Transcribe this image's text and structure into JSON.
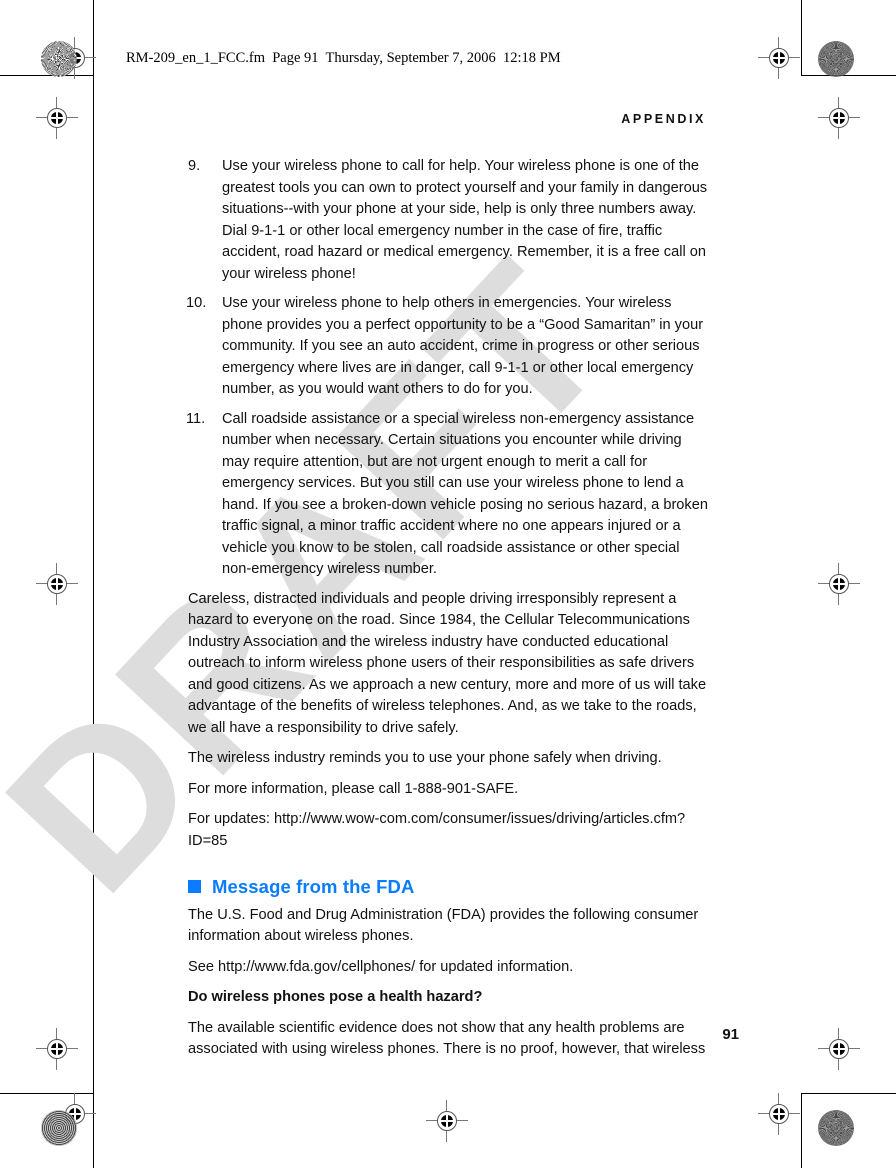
{
  "document": {
    "fm_header": "RM-209_en_1_FCC.fm  Page 91  Thursday, September 7, 2006  12:18 PM",
    "running_head": "APPENDIX",
    "folio": "91",
    "watermark": "DRAFT",
    "accent_color": "#0a7cff"
  },
  "content": {
    "numbered_items": [
      {
        "number": "9.",
        "text": "Use your wireless phone to call for help. Your wireless phone is one of the greatest tools you can own to protect yourself and your family in dangerous situations--with your phone at your side, help is only three numbers away. Dial 9-1-1 or other local emergency number in the case of fire, traffic accident, road hazard or medical emergency. Remember, it is a free call on your wireless phone!"
      },
      {
        "number": "10.",
        "text": "Use your wireless phone to help others in emergencies. Your wireless phone provides you a perfect opportunity to be a “Good Samaritan” in your community. If you see an auto accident, crime in progress or other serious emergency where lives are in danger, call 9-1-1 or other local emergency number, as you would want others to do for you."
      },
      {
        "number": "11.",
        "text": "Call roadside assistance or a special wireless non-emergency assistance number when necessary. Certain situations you encounter while driving may require attention, but are not urgent enough to merit a call for emergency services. But you still can use your wireless phone to lend a hand. If you see a broken-down vehicle posing no serious hazard, a broken traffic signal, a minor traffic accident where no one appears injured or a vehicle you know to be stolen, call roadside assistance or other special non-emergency wireless number."
      }
    ],
    "paragraph_careless": "Careless, distracted individuals and people driving irresponsibly represent a hazard to everyone on the road. Since 1984, the Cellular Telecommunications Industry Association and the wireless industry have conducted educational outreach to inform wireless phone users of their responsibilities as safe drivers and good citizens. As we approach a new century, more and more of us will take advantage of the benefits of wireless telephones. And, as we take to the roads, we all have a responsibility to drive safely.",
    "paragraph_reminder": "The wireless industry reminds you to use your phone safely when driving.",
    "paragraph_more_info": "For more information, please call 1-888-901-SAFE.",
    "paragraph_updates": "For updates: http://www.wow-com.com/consumer/issues/driving/articles.cfm?ID=85",
    "section_heading": "Message from the FDA",
    "paragraph_fda_intro": "The U.S. Food and Drug Administration (FDA) provides the following consumer information about wireless phones.",
    "paragraph_fda_see": "See http://www.fda.gov/cellphones/ for updated information.",
    "subheading_hazard": "Do wireless phones pose a health hazard?",
    "paragraph_evidence": "The available scientific evidence does not show that any health problems are associated with using wireless phones. There is no proof, however, that wireless"
  }
}
